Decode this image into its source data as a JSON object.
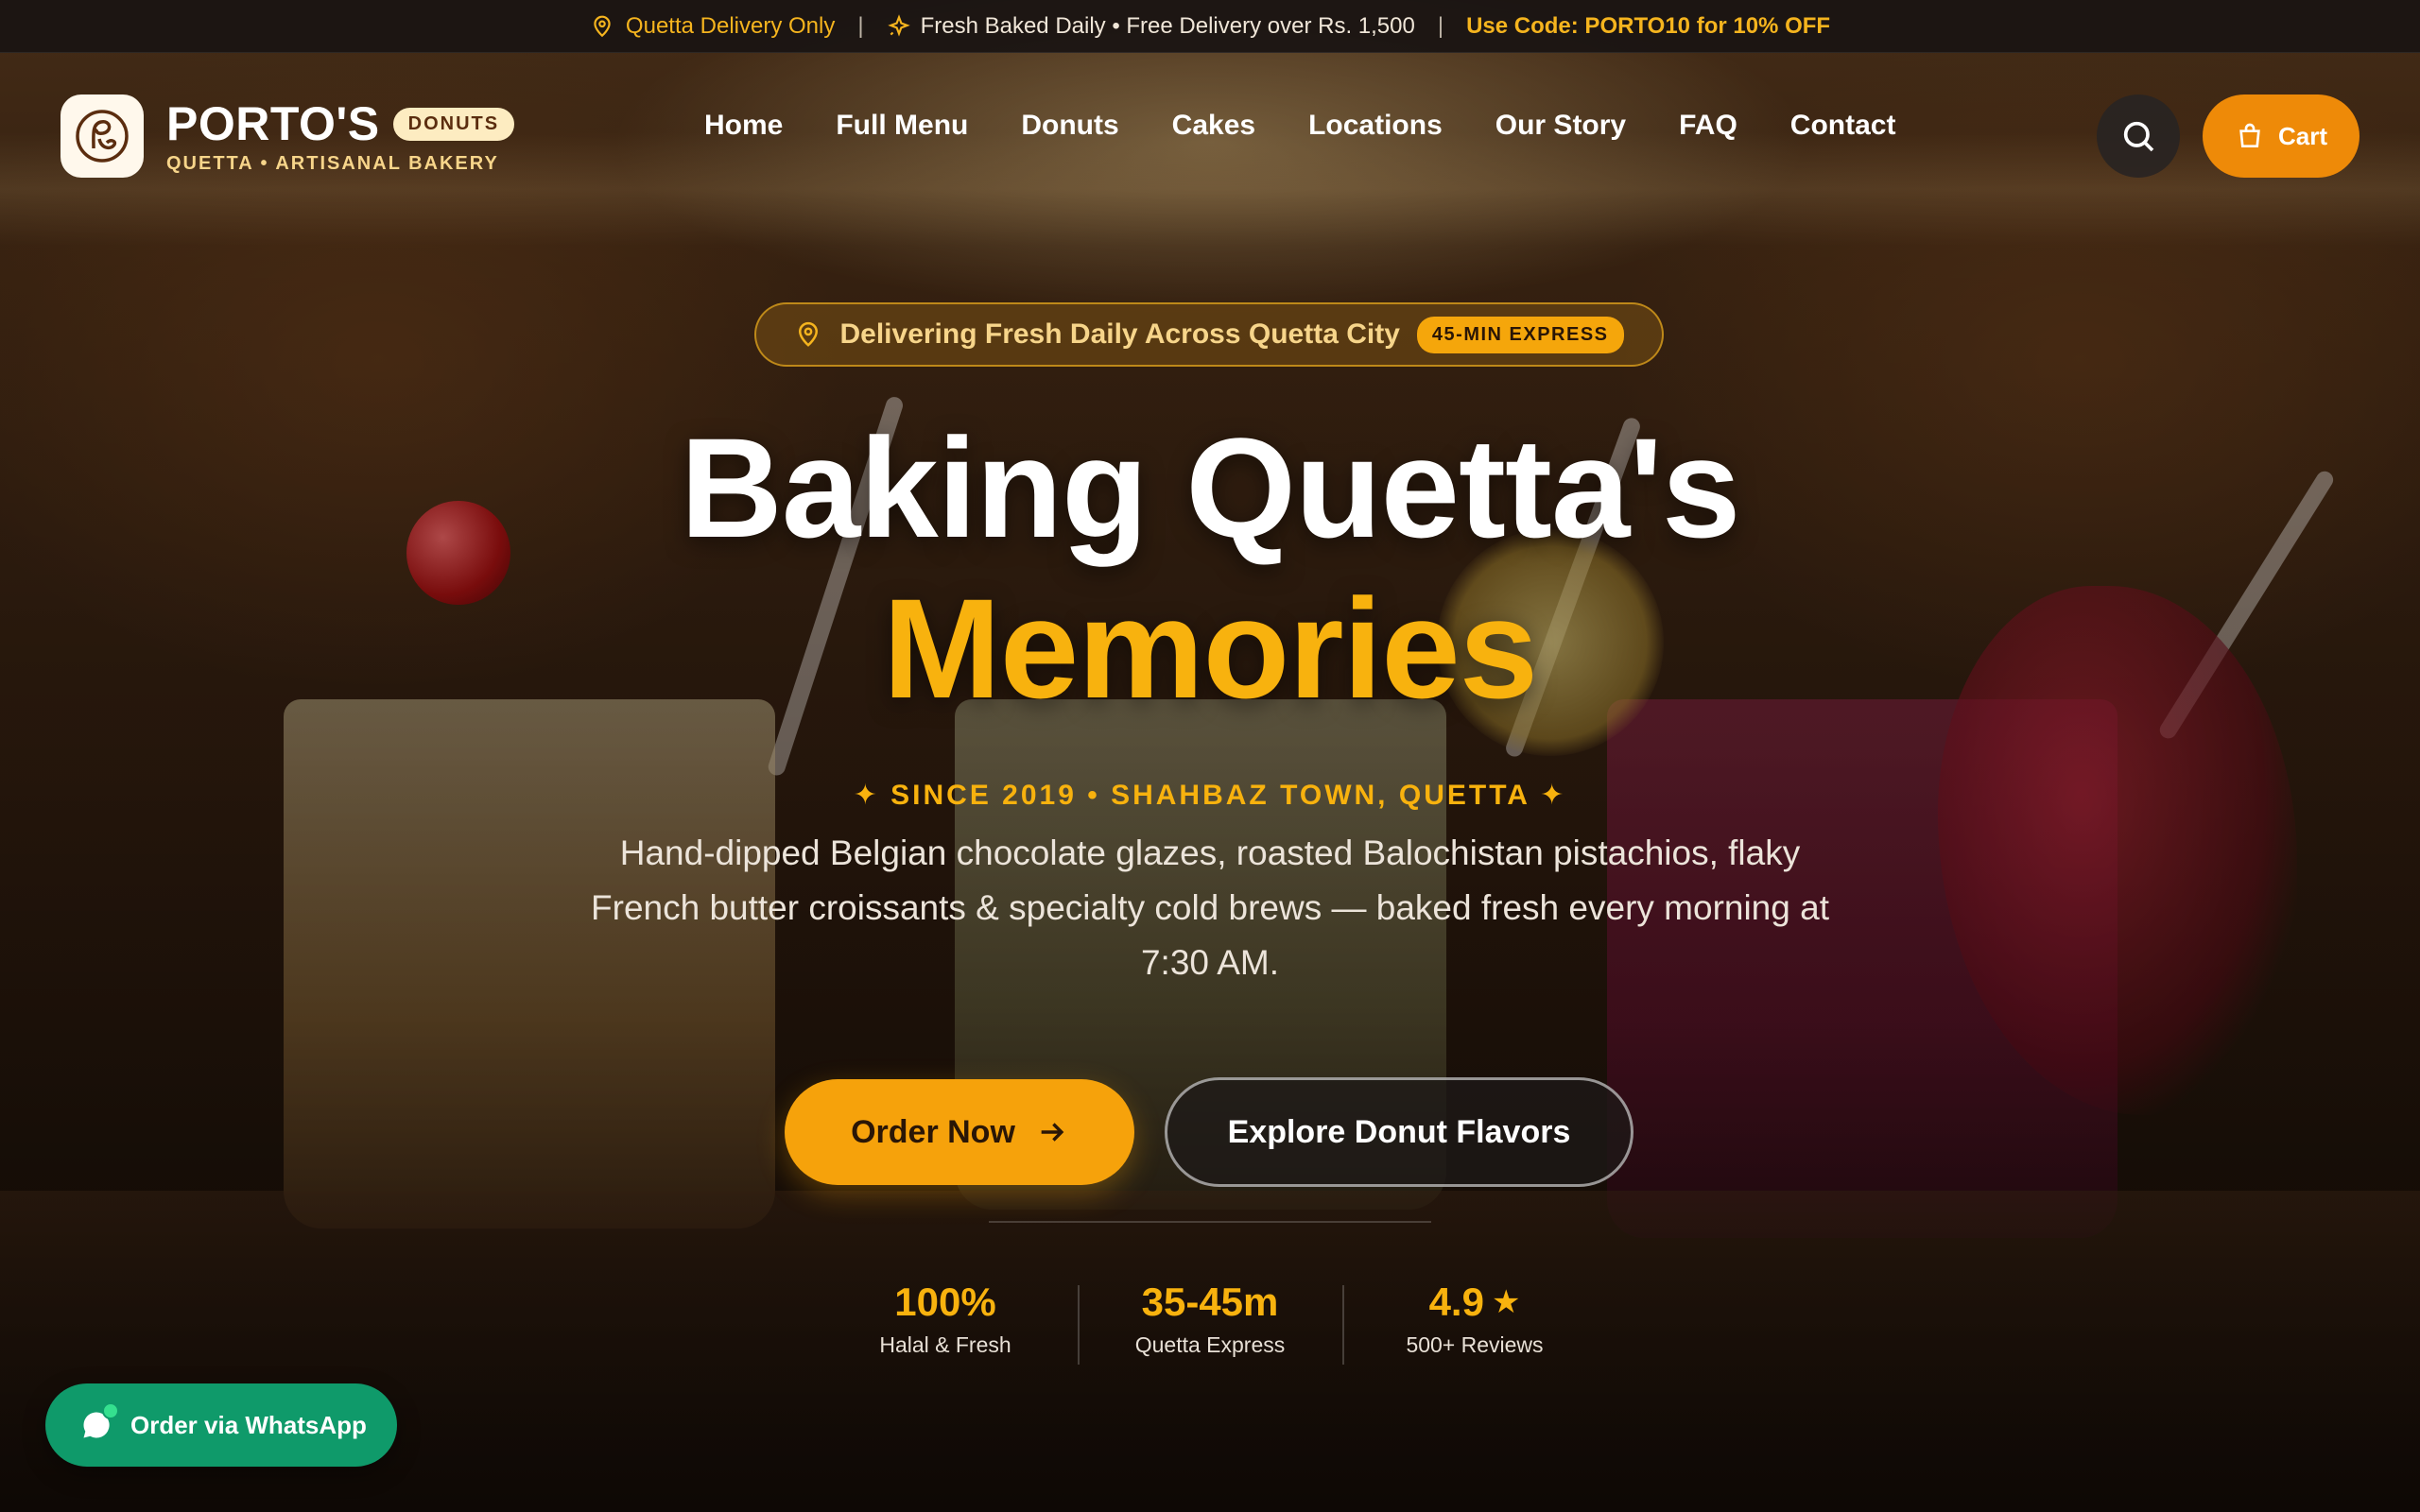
{
  "colors": {
    "accent": "#f8b20e",
    "cart": "#ee8a08",
    "whatsapp": "#0f9a6a",
    "badge_bg": "#fdecc1"
  },
  "announcement": {
    "location": "Quetta Delivery Only",
    "location_icon": "map-pin-icon",
    "separator": "|",
    "fresh": "Fresh Baked Daily • Free Delivery over Rs. 1,500",
    "fresh_icon": "sparkle-icon",
    "promo": "Use Code: PORTO10 for 10% OFF"
  },
  "brand": {
    "logo_icon": "monogram-logo-icon",
    "name": "PORTO'S",
    "badge": "DONUTS",
    "tagline": "QUETTA • ARTISANAL BAKERY"
  },
  "nav": {
    "items": [
      {
        "label": "Home"
      },
      {
        "label": "Full Menu"
      },
      {
        "label": "Donuts"
      },
      {
        "label": "Cakes"
      },
      {
        "label": "Locations"
      },
      {
        "label": "Our Story"
      },
      {
        "label": "FAQ"
      },
      {
        "label": "Contact"
      }
    ],
    "search_icon": "search-icon",
    "cart_icon": "shopping-bag-icon",
    "cart_label": "Cart"
  },
  "hero": {
    "pill_text": "Delivering Fresh Daily Across Quetta City",
    "pill_badge": "45-MIN EXPRESS",
    "title_line1": "Baking Quetta's",
    "title_line2": "Memories",
    "since": "✦ SINCE 2019 • SHAHBAZ TOWN, QUETTA ✦",
    "description": "Hand-dipped Belgian chocolate glazes, roasted Balochistan pistachios, flaky French butter croissants & specialty cold brews — baked fresh every morning at 7:30 AM.",
    "order_button": "Order Now",
    "explore_button": "Explore Donut Flavors"
  },
  "stats": [
    {
      "value": "100%",
      "label": "Halal & Fresh"
    },
    {
      "value": "35-45m",
      "label": "Quetta Express"
    },
    {
      "value": "4.9",
      "label": "500+ Reviews",
      "icon": "star-icon"
    }
  ],
  "whatsapp": {
    "label": "Order via WhatsApp",
    "icon": "chat-bubble-icon"
  }
}
